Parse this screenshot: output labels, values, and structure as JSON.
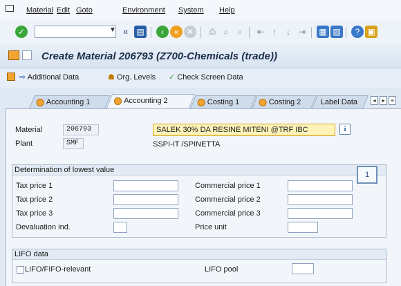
{
  "menu": [
    "Material",
    "Edit",
    "Goto",
    "Environment",
    "System",
    "Help"
  ],
  "title": "Create Material 206793 (Z700-Chemicals (trade))",
  "app_toolbar": {
    "additional_data": "Additional Data",
    "org_levels": "Org. Levels",
    "check_screen_data": "Check Screen Data"
  },
  "tabs": [
    "Accounting 1",
    "Accounting 2",
    "Costing 1",
    "Costing 2",
    "Label Data"
  ],
  "header": {
    "material_label": "Material",
    "material_value": "206793",
    "description_value": "SALEK 30% DA RESINE MITENI @TRF IBC",
    "plant_label": "Plant",
    "plant_value": "SMF",
    "plant_desc": "SSPI-IT /SPINETTA"
  },
  "lowest_value": {
    "title": "Determination of lowest value",
    "tax_price_1": "Tax price 1",
    "tax_price_2": "Tax price 2",
    "tax_price_3": "Tax price 3",
    "devaluation": "Devaluation ind.",
    "commercial_1": "Commercial price 1",
    "commercial_2": "Commercial price 2",
    "commercial_3": "Commercial price 3",
    "price_unit": "Price unit"
  },
  "lifo": {
    "title": "LIFO data",
    "relevant": "LIFO/FIFO-relevant",
    "pool": "LIFO pool"
  },
  "badge": "1",
  "colors": {
    "title_text": "#1b2f4a",
    "accent": "#f2a531",
    "background": "#dfe8f3"
  }
}
